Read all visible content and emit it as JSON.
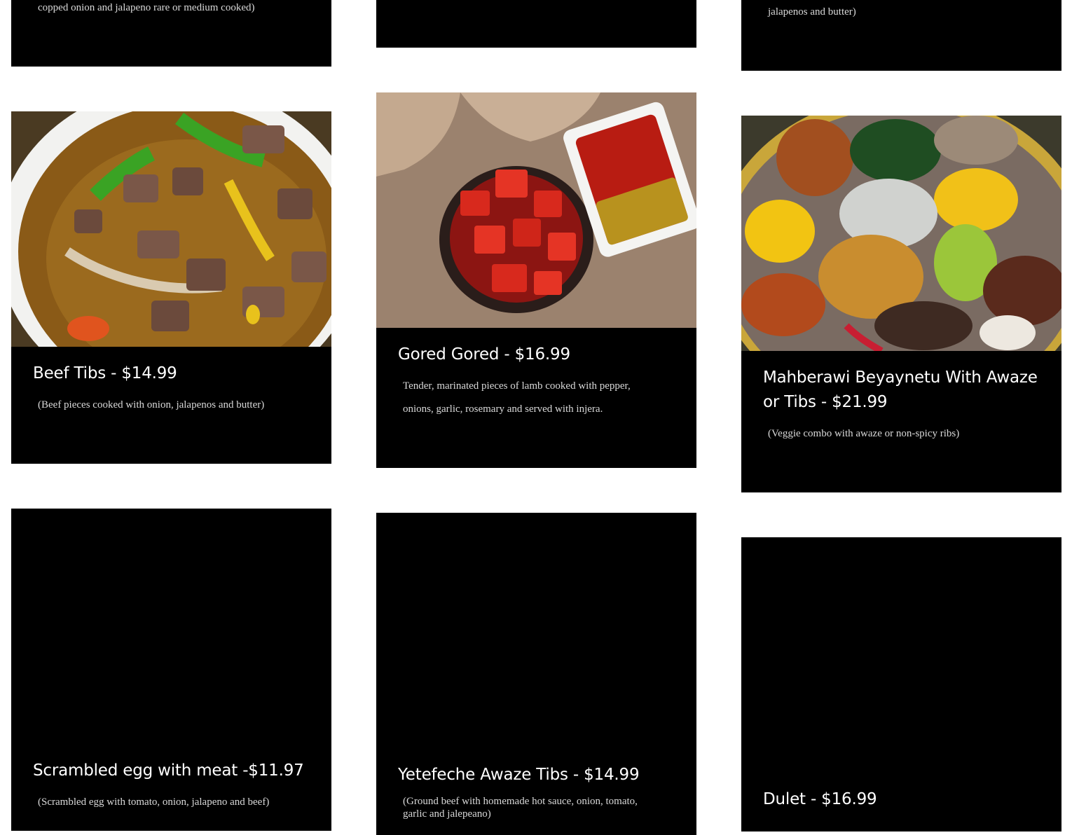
{
  "menu": {
    "top_row": [
      {
        "description": "copped onion and jalapeno rare or medium cooked)"
      },
      {
        "description": ""
      },
      {
        "description": "jalapenos and butter)"
      }
    ],
    "items": [
      {
        "title": "Beef Tibs - $14.99",
        "description": "(Beef pieces cooked with onion, jalapenos and butter)",
        "image": "beef-tibs-photo"
      },
      {
        "title": "Gored Gored - $16.99",
        "description_lines": [
          "Tender, marinated pieces of lamb cooked with pepper,",
          "onions, garlic, rosemary and served with injera."
        ],
        "image": "gored-gored-photo"
      },
      {
        "title_lines": [
          "Mahberawi Beyaynetu With Awaze",
          "or Tibs - $21.99"
        ],
        "description": "(Veggie combo with awaze or non-spicy ribs)",
        "image": "veggie-combo-photo"
      },
      {
        "title": "Scrambled egg with meat -$11.97",
        "description": "(Scrambled egg with tomato, onion, jalapeno and beef)"
      },
      {
        "title": "Yetefeche Awaze Tibs - $14.99",
        "description_lines": [
          "(Ground beef with homemade hot sauce, onion, tomato,",
          "garlic and jalepeano)"
        ]
      },
      {
        "title": "Dulet - $16.99"
      }
    ]
  },
  "colors": {
    "card_bg": "#000000",
    "title": "#ffffff",
    "desc": "#d9d9d9",
    "page_bg": "#ffffff"
  }
}
